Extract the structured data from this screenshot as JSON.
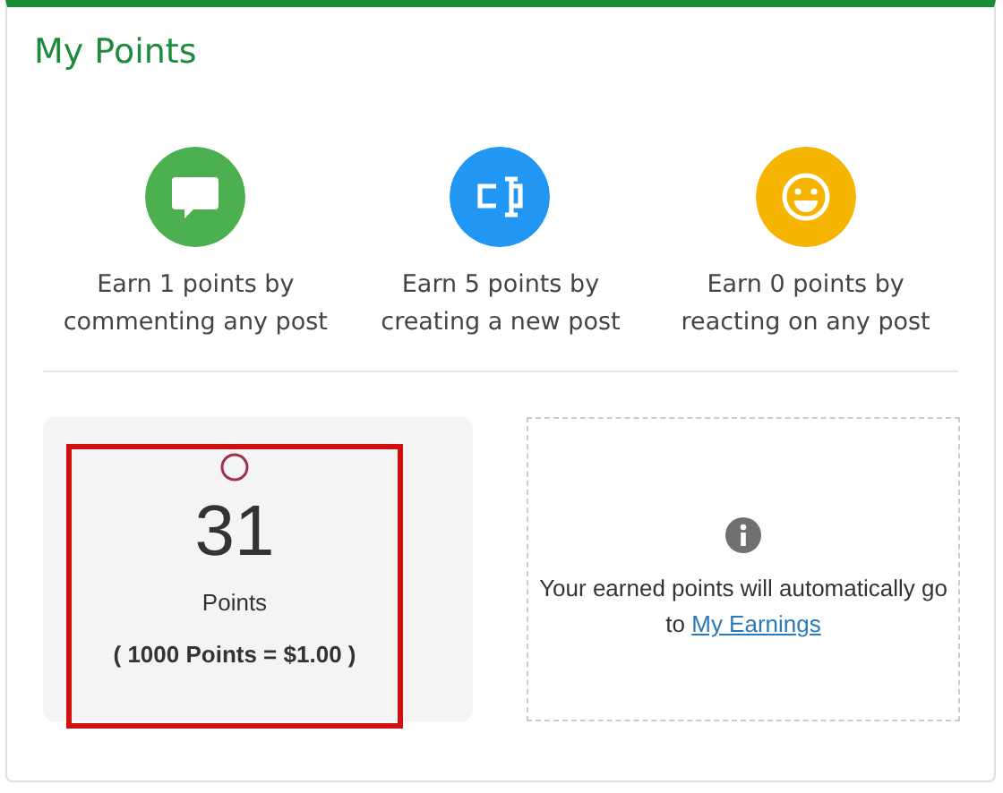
{
  "title": "My Points",
  "rules": [
    {
      "kind": "comment",
      "color": "#4caf50",
      "text": "Earn 1 points by commenting any post"
    },
    {
      "kind": "edit",
      "color": "#2196f3",
      "text": "Earn 5 points by creating a new post"
    },
    {
      "kind": "smile",
      "color": "#f4b400",
      "text": "Earn 0 points by reacting on any post"
    }
  ],
  "balance": {
    "highlighted": true,
    "points": "31",
    "unit": "Points",
    "rate": "( 1000 Points = $1.00 )"
  },
  "info": {
    "text": "Your earned points will automatically go to",
    "link": "My Earnings"
  }
}
